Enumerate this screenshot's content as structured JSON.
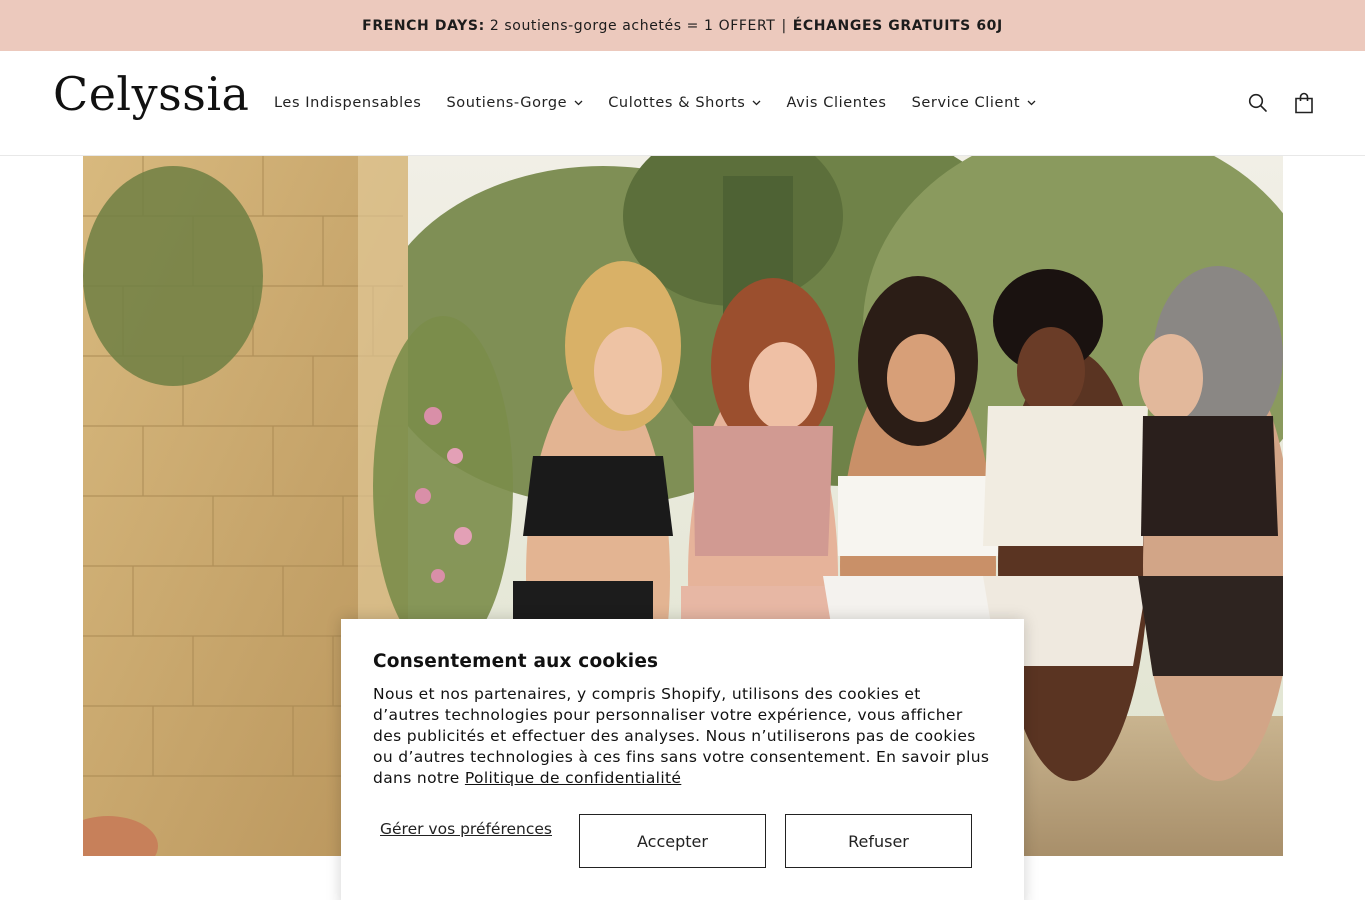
{
  "announcement": {
    "lead": "FRENCH DAYS:",
    "offer": "2 soutiens-gorge achetés = 1 OFFERT",
    "separator": "|",
    "exchange": "ÉCHANGES GRATUITS 60J"
  },
  "header": {
    "logo": "Celyssia",
    "nav": [
      {
        "label": "Les Indispensables"
      },
      {
        "label": "Soutiens-Gorge"
      },
      {
        "label": "Culottes & Shorts"
      },
      {
        "label": "Avis Clientes"
      },
      {
        "label": "Service Client"
      }
    ],
    "icons": {
      "search": "search-icon",
      "cart": "shopping-bag-icon"
    }
  },
  "cookie_banner": {
    "title": "Consentement aux cookies",
    "body": "Nous et nos partenaires, y compris Shopify, utilisons des cookies et d’autres technologies pour personnaliser votre expérience, vous afficher des publicités et effectuer des analyses. Nous n’utiliserons pas de cookies ou d’autres technologies à ces fins sans votre consentement. En savoir plus dans notre",
    "privacy_link": "Politique de confidentialité",
    "manage_label": "Gérer vos préférences",
    "accept_label": "Accepter",
    "refuse_label": "Refuser"
  }
}
